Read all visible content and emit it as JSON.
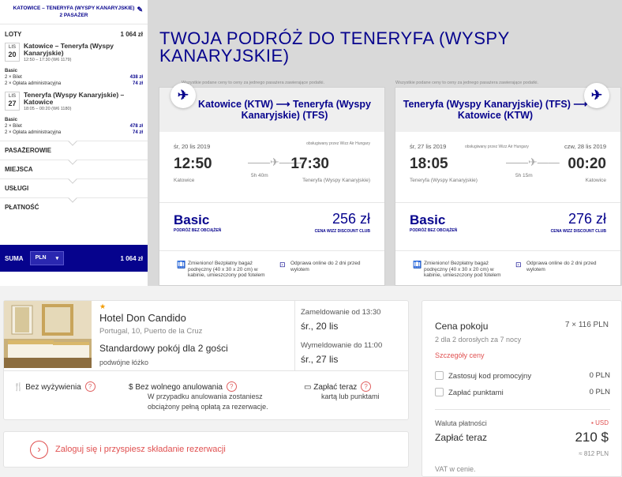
{
  "sidebar": {
    "trip": "KATOWICE – TENERYFA (WYSPY KANARYJSKIE)",
    "passengers": "2 PASAŻER",
    "flights_label": "LOTY",
    "flights_total": "1 064 zł",
    "flight1": {
      "month": "LIS",
      "day": "20",
      "route": "Katowice – Teneryfa (Wyspy Kanaryjskie)",
      "time": "12:50 – 17:30 (W6 1179)",
      "fare_label": "Basic",
      "line1": "2 × Bilet",
      "line1_value": "438 zł",
      "line2": "2 × Opłata administracyjna",
      "line2_value": "74 zł"
    },
    "flight2": {
      "month": "LIS",
      "day": "27",
      "route": "Teneryfa (Wyspy Kanaryjskie) – Katowice",
      "time": "18:05 – 00:20 (W6 1180)",
      "fare_label": "Basic",
      "line1": "2 × Bilet",
      "line1_value": "478 zł",
      "line2": "2 × Opłata administracyjna",
      "line2_value": "74 zł"
    },
    "sections": [
      "PASAŻEROWIE",
      "MIEJSCA",
      "USŁUGI",
      "PŁATNOŚĆ"
    ],
    "sum_label": "SUMA",
    "currency": "PLN",
    "sum_value": "1 064 zł"
  },
  "main_title": "TWOJA PODRÓŻ DO TENERYFA (WYSPY KANARYJSKIE)",
  "price_note": "Wszystkie podane ceny to ceny za jednego pasażera zawierające podatki.",
  "outbound": {
    "route": "Katowice (KTW) ⟶ Teneryfa (Wyspy Kanaryjskie) (TFS)",
    "date": "śr, 20 lis 2019",
    "operator": "obsługiwany przez Wizz Air Hungary",
    "dep_time": "12:50",
    "dep_city": "Katowice",
    "duration": "5h 40m",
    "arr_time": "17:30",
    "arr_city": "Teneryfa (Wyspy Kanaryjskie)",
    "fare": "Basic",
    "fare_sub": "PODRÓŻ BEZ OBCIĄŻEŃ",
    "price": "256 zł",
    "club": "CENA WIZZ DISCOUNT CLUB",
    "perk1": "Zmieniono! Bezpłatny bagaż podręczny (40 x 30 x 20 cm) w kabinie, umieszczony pod fotelem",
    "perk2": "Odprawa online do 2 dni przed wylotem"
  },
  "inbound": {
    "route": "Teneryfa (Wyspy Kanaryjskie) (TFS) ⟶ Katowice (KTW)",
    "date": "śr, 27 lis 2019",
    "operator": "obsługiwany przez Wizz Air Hungary",
    "arr_date": "czw, 28 lis 2019",
    "dep_time": "18:05",
    "dep_city": "Teneryfa (Wyspy Kanaryjskie)",
    "duration": "5h 15m",
    "arr_time": "00:20",
    "arr_city": "Katowice",
    "fare": "Basic",
    "fare_sub": "PODRÓŻ BEZ OBCIĄŻEŃ",
    "price": "276 zł",
    "club": "CENA WIZZ DISCOUNT CLUB",
    "perk1": "Zmieniono! Bezpłatny bagaż podręczny (40 x 30 x 20 cm) w kabinie, umieszczony pod fotelem",
    "perk2": "Odprawa online do 2 dni przed wylotem"
  },
  "hotel": {
    "stars": "★",
    "name": "Hotel Don Candido",
    "address": "Portugal, 10, Puerto de la Cruz",
    "room": "Standardowy pokój dla 2 gości",
    "bed": "podwójne łóżko",
    "checkin_label": "Zameldowanie od 13:30",
    "checkin_date": "śr., 20 lis",
    "checkout_label": "Wymeldowanie do 11:00",
    "checkout_date": "śr., 27 lis",
    "meal": "Bez wyżywienia",
    "cancel": "Bez wolnego anulowania",
    "cancel_desc": "W przypadku anulowania zostaniesz obciążony pełną opłatą za rezerwacje.",
    "pay_now": "Zapłać teraz",
    "pay_desc": "kartą lub punktami"
  },
  "login_text": "Zaloguj się i przyspiesz składanie rezerwacji",
  "pricing": {
    "room_price_label": "Cena pokoju",
    "room_calc": "7 × 116 PLN",
    "guests": "2 dla 2 dorosłych  za 7 nocy",
    "details_link": "Szczegóły ceny",
    "promo_label": "Zastosuj kod promocyjny",
    "promo_value": "0 PLN",
    "points_label": "Zapłać punktami",
    "points_value": "0 PLN",
    "currency_label": "Waluta płatności",
    "currency_value": "▪ USD",
    "pay_label": "Zapłać teraz",
    "total": "210 $",
    "total_pln": "≈ 812 PLN",
    "vat": "VAT w cenie."
  }
}
